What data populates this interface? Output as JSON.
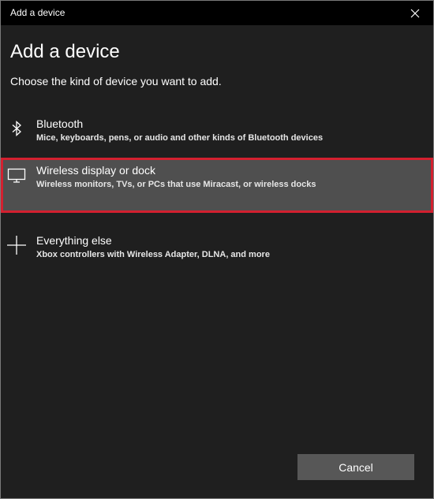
{
  "window": {
    "title": "Add a device"
  },
  "heading": "Add a device",
  "subtitle": "Choose the kind of device you want to add.",
  "options": [
    {
      "title": "Bluetooth",
      "description": "Mice, keyboards, pens, or audio and other kinds of Bluetooth devices",
      "icon": "bluetooth-icon",
      "selected": false
    },
    {
      "title": "Wireless display or dock",
      "description": "Wireless monitors, TVs, or PCs that use Miracast, or wireless docks",
      "icon": "monitor-icon",
      "selected": true
    },
    {
      "title": "Everything else",
      "description": "Xbox controllers with Wireless Adapter, DLNA, and more",
      "icon": "plus-icon",
      "selected": false
    }
  ],
  "buttons": {
    "cancel": "Cancel"
  },
  "colors": {
    "background": "#1f1f1f",
    "titlebar": "#000000",
    "selected_background": "#4f4f4f",
    "highlight_border": "#d3202f",
    "button": "#575757"
  }
}
